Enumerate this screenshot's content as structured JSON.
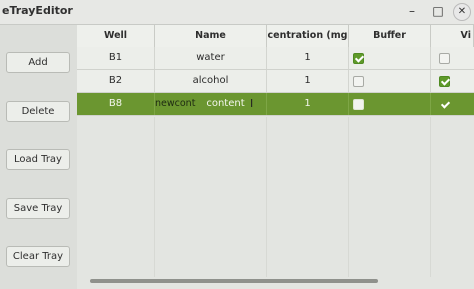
{
  "window": {
    "title": "eTrayEditor",
    "minimize_glyph": "–",
    "maximize_glyph": "□",
    "close_glyph": "✕"
  },
  "sidebar": {
    "add_label": "Add",
    "delete_label": "Delete",
    "load_label": "Load Tray",
    "save_label": "Save Tray",
    "clear_label": "Clear Tray"
  },
  "table": {
    "columns": [
      "Well",
      "Name",
      "centration (mg",
      "Buffer",
      "Vi"
    ],
    "rows": [
      {
        "well": "B1",
        "name": "water",
        "conc": "1",
        "buffer": true,
        "vis": false
      },
      {
        "well": "B2",
        "name": "alcohol",
        "conc": "1",
        "buffer": false,
        "vis": true
      },
      {
        "well": "B8",
        "name": "content",
        "conc": "1",
        "buffer": false,
        "vis": true
      }
    ],
    "editing_text": "newcont"
  },
  "colors": {
    "selected_row": "#6b9630",
    "checkbox_checked": "#5f9a2a"
  }
}
